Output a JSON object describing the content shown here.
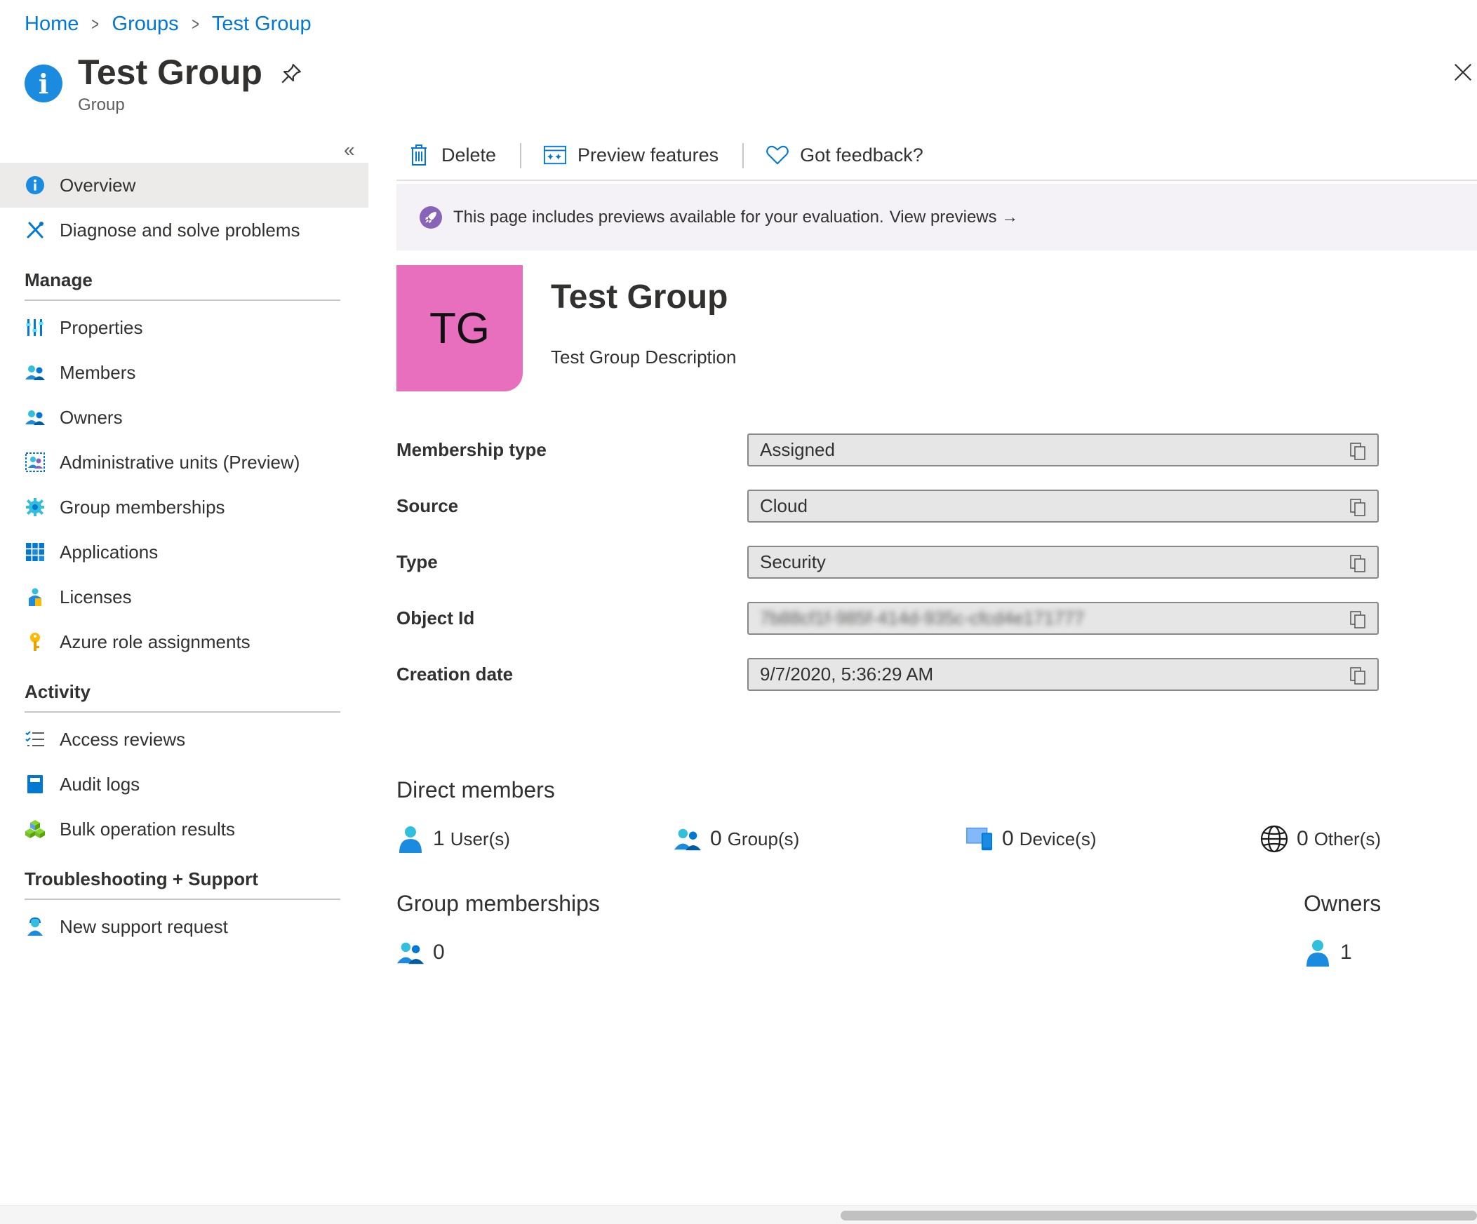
{
  "breadcrumb": {
    "items": [
      "Home",
      "Groups",
      "Test Group"
    ],
    "separator": ">"
  },
  "header": {
    "title": "Test Group",
    "subtitle": "Group",
    "icon": "info-icon"
  },
  "sidebar": {
    "collapse_glyph": "«",
    "top_items": [
      {
        "label": "Overview",
        "icon": "info-icon",
        "active": true
      },
      {
        "label": "Diagnose and solve problems",
        "icon": "tools-icon"
      }
    ],
    "sections": [
      {
        "title": "Manage",
        "items": [
          {
            "label": "Properties",
            "icon": "properties-icon"
          },
          {
            "label": "Members",
            "icon": "members-icon"
          },
          {
            "label": "Owners",
            "icon": "owners-icon"
          },
          {
            "label": "Administrative units (Preview)",
            "icon": "admin-units-icon"
          },
          {
            "label": "Group memberships",
            "icon": "gear-icon"
          },
          {
            "label": "Applications",
            "icon": "grid-icon"
          },
          {
            "label": "Licenses",
            "icon": "licenses-icon"
          },
          {
            "label": "Azure role assignments",
            "icon": "key-icon"
          }
        ]
      },
      {
        "title": "Activity",
        "items": [
          {
            "label": "Access reviews",
            "icon": "checklist-icon"
          },
          {
            "label": "Audit logs",
            "icon": "book-icon"
          },
          {
            "label": "Bulk operation results",
            "icon": "cubes-icon"
          }
        ]
      },
      {
        "title": "Troubleshooting + Support",
        "items": [
          {
            "label": "New support request",
            "icon": "support-icon"
          }
        ]
      }
    ]
  },
  "toolbar": {
    "delete_label": "Delete",
    "preview_label": "Preview features",
    "feedback_label": "Got feedback?"
  },
  "banner": {
    "text": "This page includes previews available for your evaluation.",
    "link": "View previews →"
  },
  "group": {
    "initials": "TG",
    "name": "Test Group",
    "description": "Test Group Description",
    "avatar_color": "#e76fbe"
  },
  "properties": [
    {
      "label": "Membership type",
      "value": "Assigned",
      "blurred": false
    },
    {
      "label": "Source",
      "value": "Cloud",
      "blurred": false
    },
    {
      "label": "Type",
      "value": "Security",
      "blurred": false
    },
    {
      "label": "Object Id",
      "value": "7b88cf1f-985f-414d-935c-cfcd4e171777",
      "blurred": true
    },
    {
      "label": "Creation date",
      "value": "9/7/2020, 5:36:29 AM",
      "blurred": false
    }
  ],
  "direct_members": {
    "title": "Direct members",
    "users": {
      "count": "1",
      "label": "User(s)"
    },
    "groups": {
      "count": "0",
      "label": "Group(s)"
    },
    "devices": {
      "count": "0",
      "label": "Device(s)"
    },
    "others": {
      "count": "0",
      "label": "Other(s)"
    }
  },
  "group_memberships": {
    "title": "Group memberships",
    "count": "0"
  },
  "owners": {
    "title": "Owners",
    "count": "1"
  },
  "colors": {
    "accent": "#0078d4",
    "active_nav_bg": "#edebe9",
    "banner_bg": "#f4f1f7",
    "rocket": "#8764b8"
  }
}
